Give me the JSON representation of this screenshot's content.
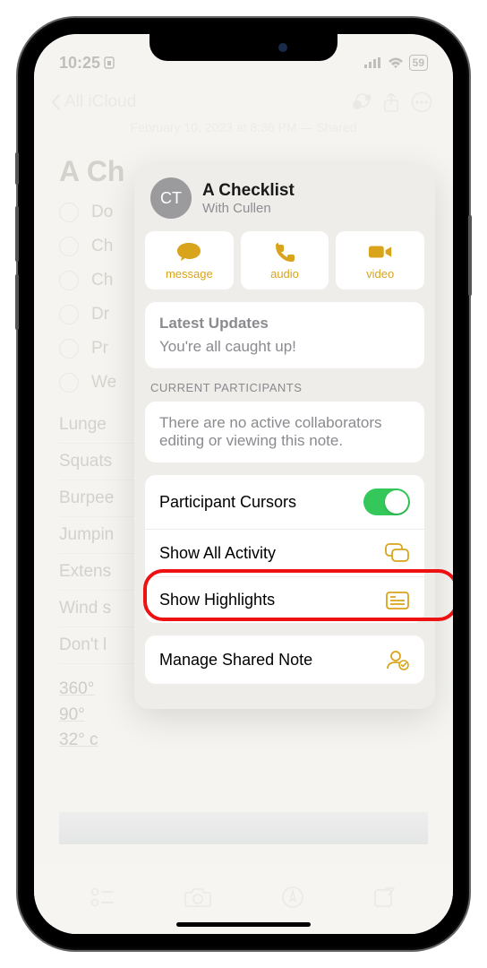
{
  "status": {
    "time": "10:25",
    "battery": "59"
  },
  "nav": {
    "back": "All iCloud"
  },
  "timestamp": "February 10, 2023 at 8:36 PM — Shared",
  "note": {
    "title": "A Checklist",
    "checks": [
      "Do",
      "Ch",
      "Ch",
      "Dr",
      "Pr",
      "We"
    ],
    "table": [
      "Lunge",
      "Squats",
      "Burpee",
      "Jumpin",
      "Extens",
      "Wind s",
      "Don't l"
    ],
    "degrees": [
      "360°",
      "90°",
      "32° c"
    ]
  },
  "popover": {
    "avatar": "CT",
    "title": "A Checklist",
    "subtitle": "With Cullen",
    "actions": {
      "message": "message",
      "audio": "audio",
      "video": "video"
    },
    "updates": {
      "title": "Latest Updates",
      "text": "You're all caught up!"
    },
    "participants": {
      "label": "CURRENT PARTICIPANTS",
      "text": "There are no active collaborators editing or viewing this note."
    },
    "rows": {
      "cursors": "Participant Cursors",
      "activity": "Show All Activity",
      "highlights": "Show Highlights",
      "manage": "Manage Shared Note"
    }
  },
  "colors": {
    "accent": "#d9a41c",
    "toggle_on": "#34c759",
    "highlight": "#e11"
  }
}
